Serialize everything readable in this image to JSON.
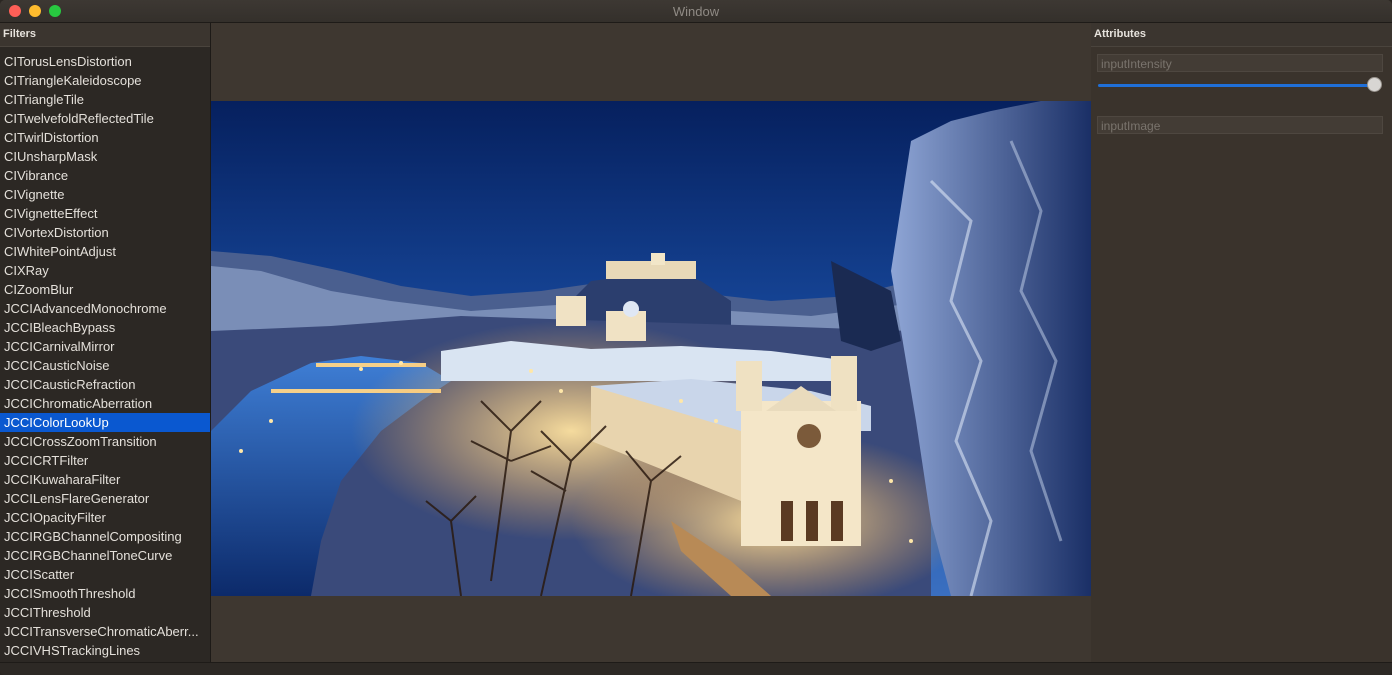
{
  "window": {
    "title": "Window"
  },
  "filters": {
    "header": "Filters",
    "selected_index": 19,
    "items": [
      "CITorusLensDistortion",
      "CITriangleKaleidoscope",
      "CITriangleTile",
      "CITwelvefoldReflectedTile",
      "CITwirlDistortion",
      "CIUnsharpMask",
      "CIVibrance",
      "CIVignette",
      "CIVignetteEffect",
      "CIVortexDistortion",
      "CIWhitePointAdjust",
      "CIXRay",
      "CIZoomBlur",
      "JCCIAdvancedMonochrome",
      "JCCIBleachBypass",
      "JCCICarnivalMirror",
      "JCCICausticNoise",
      "JCCICausticRefraction",
      "JCCIChromaticAberration",
      "JCCIColorLookUp",
      "JCCICrossZoomTransition",
      "JCCICRTFilter",
      "JCCIKuwaharaFilter",
      "JCCILensFlareGenerator",
      "JCCIOpacityFilter",
      "JCCIRGBChannelCompositing",
      "JCCIRGBChannelToneCurve",
      "JCCIScatter",
      "JCCISmoothThreshold",
      "JCCIThreshold",
      "JCCITransverseChromaticAberr...",
      "JCCIVHSTrackingLines"
    ]
  },
  "attributes": {
    "header": "Attributes",
    "input_intensity_placeholder": "inputIntensity",
    "input_intensity_value": 1.0,
    "input_image_placeholder": "inputImage"
  },
  "colors": {
    "selection": "#0a58d0",
    "slider_accent": "#1f6fd8"
  }
}
